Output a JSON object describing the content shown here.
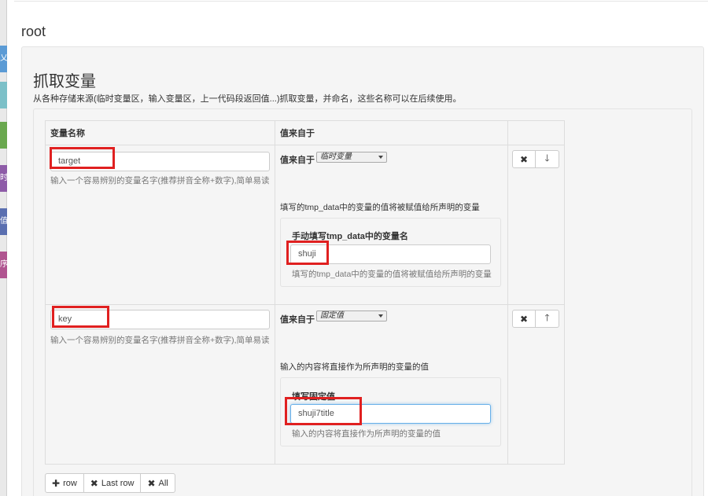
{
  "background": {
    "sliver_tabs": [
      {
        "label": "乂",
        "color": "#5b9bd5"
      },
      {
        "label": "",
        "color": "#7cc0c8"
      },
      {
        "label": "",
        "color": "#6aa84f"
      },
      {
        "label": "时",
        "color": "#8e5ca8"
      },
      {
        "label": "值",
        "color": "#5a6fb0"
      },
      {
        "label": "序",
        "color": "#b05590"
      }
    ]
  },
  "page": {
    "root_title": "root",
    "panel_title": "抓取变量",
    "panel_desc": "从各种存储来源(临时变量区，输入变量区，上一代码段返回值...)抓取变量，并命名，这些名称可以在后续使用。"
  },
  "table": {
    "headers": [
      "变量名称",
      "值来自于",
      ""
    ],
    "rows": [
      {
        "var_name": "target",
        "var_help": "输入一个容易辨别的变量名字(推荐拼音全称+数字),简单易读",
        "source_label": "值来自于",
        "source_selected": "临时变量",
        "source_info": "填写的tmp_data中的变量的值将被赋值给所声明的变量",
        "well_label": "手动填写tmp_data中的变量名",
        "well_value": "shuji",
        "well_help": "填写的tmp_data中的变量的值将被赋值给所声明的变量",
        "delete_icon": "✖",
        "move_icon": "🡓",
        "move_icon_name": "arrow-down-icon"
      },
      {
        "var_name": "key",
        "var_help": "输入一个容易辨别的变量名字(推荐拼音全称+数字),简单易读",
        "source_label": "值来自于",
        "source_selected": "固定值",
        "source_info": "输入的内容将直接作为所声明的变量的值",
        "well_label": "填写固定值",
        "well_value": "shuji7title",
        "well_help": "输入的内容将直接作为所声明的变量的值",
        "delete_icon": "✖",
        "move_icon": "🡑",
        "move_icon_name": "arrow-up-icon"
      }
    ]
  },
  "footer": {
    "add_row_label": "row",
    "last_row_label": "Last row",
    "all_label": "All",
    "plus_icon": "✚",
    "x_icon": "✖"
  },
  "colors": {
    "annotation_red": "#e02020",
    "focus_blue": "#66afe9"
  }
}
